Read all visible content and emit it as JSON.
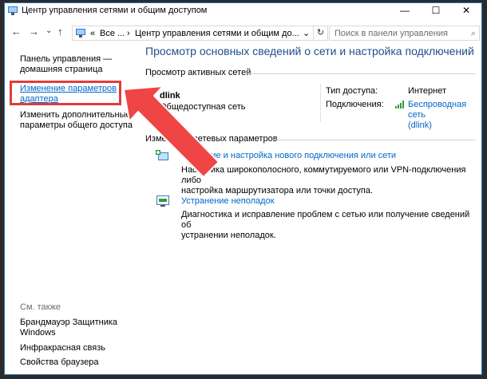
{
  "window": {
    "title": "Центр управления сетями и общим доступом",
    "min_glyph": "—",
    "max_glyph": "☐",
    "close_glyph": "✕"
  },
  "nav": {
    "back": "←",
    "forward": "→",
    "down": "⌄",
    "up": "↑",
    "address_overflow": "«",
    "address_seg1": "Все ...",
    "address_sep": "›",
    "address_seg2": "Центр управления сетями и общим до...",
    "address_chevron": "⌄",
    "refresh": "↻",
    "search_placeholder": "Поиск в панели управления",
    "search_icon": "⌕"
  },
  "sidebar": {
    "home_link": [
      "Панель управления —",
      "домашняя страница"
    ],
    "adapter_link": [
      "Изменение параметров",
      "адаптера"
    ],
    "sharing_link": [
      "Изменить дополнительные",
      "параметры общего доступа"
    ],
    "see_also": "См. также",
    "see_also_links": [
      [
        "Брандмауэр Защитника",
        "Windows"
      ],
      [
        "Инфракрасная связь"
      ],
      [
        "Свойства браузера"
      ]
    ]
  },
  "main": {
    "title": "Просмотр основных сведений о сети и настройка подключений",
    "active_networks_header": "Просмотр активных сетей",
    "network_name": "dlink",
    "network_type": "Общедоступная сеть",
    "access_type_label": "Тип доступа:",
    "access_type_value": "Интернет",
    "connections_label": "Подключения:",
    "connection_link": [
      "Беспроводная сеть",
      "(dlink)"
    ],
    "change_settings_header": "Изменение сетевых параметров",
    "tasks": [
      {
        "link": "Создание и настройка нового подключения или сети",
        "desc": [
          "Настройка широкополосного, коммутируемого или VPN-подключения либо",
          "настройка маршрутизатора или точки доступа."
        ]
      },
      {
        "link": "Устранение неполадок",
        "desc": [
          "Диагностика и исправление проблем с сетью или получение сведений об",
          "устранении неполадок."
        ]
      }
    ]
  },
  "colors": {
    "accent": "#1e73be",
    "link": "#0066cc",
    "title_blue": "#1e4e8c",
    "highlight": "#e23b3b"
  }
}
